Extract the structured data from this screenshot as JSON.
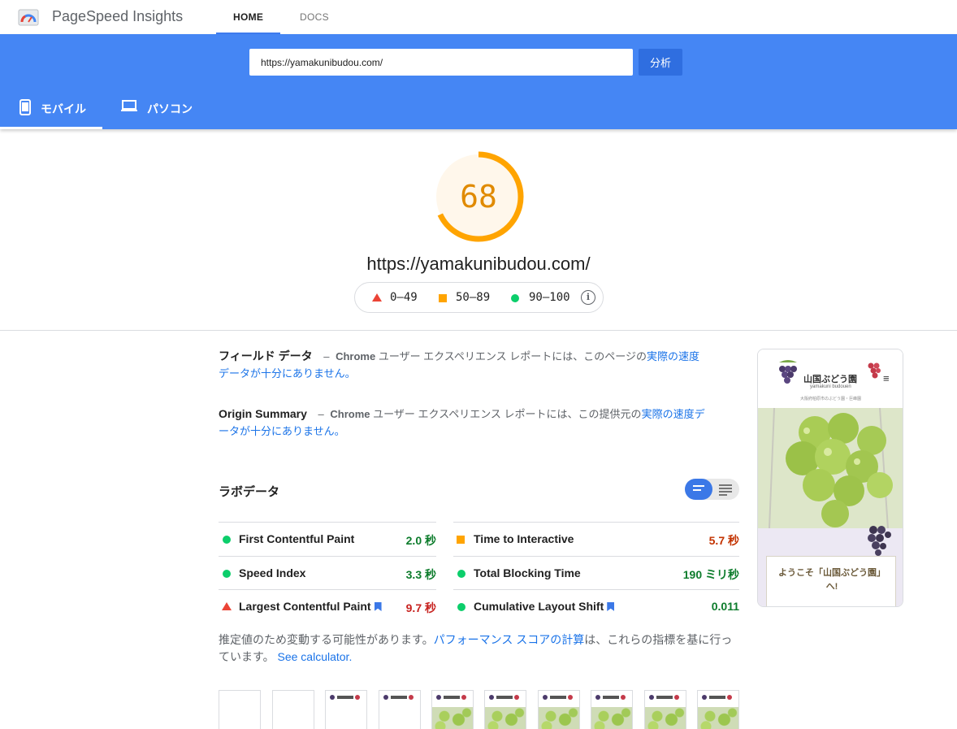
{
  "app": {
    "brand": "PageSpeed Insights"
  },
  "nav": {
    "home": "HOME",
    "docs": "DOCS"
  },
  "search": {
    "url_value": "https://yamakunibudou.com/",
    "analyze_label": "分析"
  },
  "device_tabs": {
    "mobile": "モバイル",
    "desktop": "パソコン"
  },
  "score": {
    "value": "68",
    "fraction": 0.68,
    "color": "#ffa400"
  },
  "page_url": "https://yamakunibudou.com/",
  "legend": {
    "poor": "0–49",
    "average": "50–89",
    "good": "90–100"
  },
  "field_data": {
    "title": "フィールド データ",
    "dash": "–",
    "chrome": "Chrome",
    "text": " ユーザー エクスペリエンス レポートには、このページの",
    "link": "実際の速度データが十分にありません。"
  },
  "origin_summary": {
    "title": "Origin Summary",
    "dash": "–",
    "chrome": "Chrome",
    "text": " ユーザー エクスペリエンス レポートには、この提供元の",
    "link": "実際の速度データが十分にありません。"
  },
  "lab": {
    "title": "ラボデータ",
    "metrics_left": [
      {
        "name": "First Contentful Paint",
        "value": "2.0 秒",
        "status": "good"
      },
      {
        "name": "Speed Index",
        "value": "3.3 秒",
        "status": "good"
      },
      {
        "name": "Largest Contentful Paint",
        "value": "9.7 秒",
        "status": "poor"
      }
    ],
    "metrics_right": [
      {
        "name": "Time to Interactive",
        "value": "5.7 秒",
        "status": "average"
      },
      {
        "name": "Total Blocking Time",
        "value": "190 ミリ秒",
        "status": "good"
      },
      {
        "name": "Cumulative Layout Shift",
        "value": "0.011",
        "status": "good"
      }
    ]
  },
  "estimate": {
    "text1": "推定値のため変動する可能性があります。",
    "link1": "パフォーマンス スコアの計算",
    "text2": "は、これらの指標を基に行っています。",
    "link2": "See calculator."
  },
  "preview": {
    "site_name": "山国ぶどう園",
    "site_romaji": "yamakuni budouen",
    "tagline": "大阪府柏原市のぶどう園・巨峰園",
    "welcome": "ようこそ「山国ぶどう園」へ!"
  },
  "colors": {
    "accent": "#4586f4",
    "good": "#0cce6b",
    "average": "#ffa400",
    "poor": "#eb4436"
  }
}
